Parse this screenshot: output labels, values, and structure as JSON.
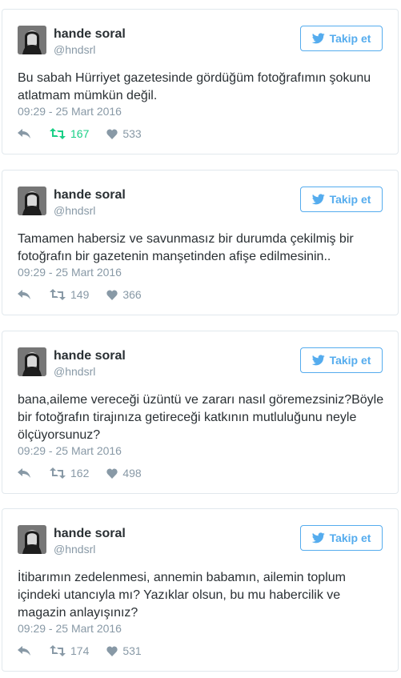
{
  "colors": {
    "accent": "#55acee",
    "retweet_active": "#19cf86",
    "muted": "#8899a6",
    "text": "#292f33",
    "border": "#e1e8ed"
  },
  "tweets": [
    {
      "name": "hande soral",
      "handle": "@hndsrl",
      "follow_label": "Takip et",
      "text": "Bu sabah Hürriyet gazetesinde gördüğüm fotoğrafımın şokunu atlatmam mümkün değil.",
      "time": "09:29 - 25 Mart 2016",
      "retweets": "167",
      "likes": "533",
      "retweet_active": true
    },
    {
      "name": "hande soral",
      "handle": "@hndsrl",
      "follow_label": "Takip et",
      "text": "Tamamen habersiz ve savunmasız bir durumda çekilmiş bir fotoğrafın bir gazetenin manşetinden afişe edilmesinin..",
      "time": "09:29 - 25 Mart 2016",
      "retweets": "149",
      "likes": "366",
      "retweet_active": false
    },
    {
      "name": "hande soral",
      "handle": "@hndsrl",
      "follow_label": "Takip et",
      "text": "bana,aileme vereceği üzüntü ve zararı nasıl göremezsiniz?Böyle bir fotoğrafın tirajınıza getireceği katkının mutluluğunu neyle ölçüyorsunuz?",
      "time": "09:29 - 25 Mart 2016",
      "retweets": "162",
      "likes": "498",
      "retweet_active": false
    },
    {
      "name": "hande soral",
      "handle": "@hndsrl",
      "follow_label": "Takip et",
      "text": "İtibarımın zedelenmesi, annemin babamın, ailemin toplum içindeki utancıyla mı? Yazıklar olsun, bu mu habercilik ve magazin anlayışınız?",
      "time": "09:29 - 25 Mart 2016",
      "retweets": "174",
      "likes": "531",
      "retweet_active": false
    }
  ],
  "icons": {
    "follow": "twitter-bird-icon",
    "reply": "reply-icon",
    "retweet": "retweet-icon",
    "like": "heart-icon"
  }
}
